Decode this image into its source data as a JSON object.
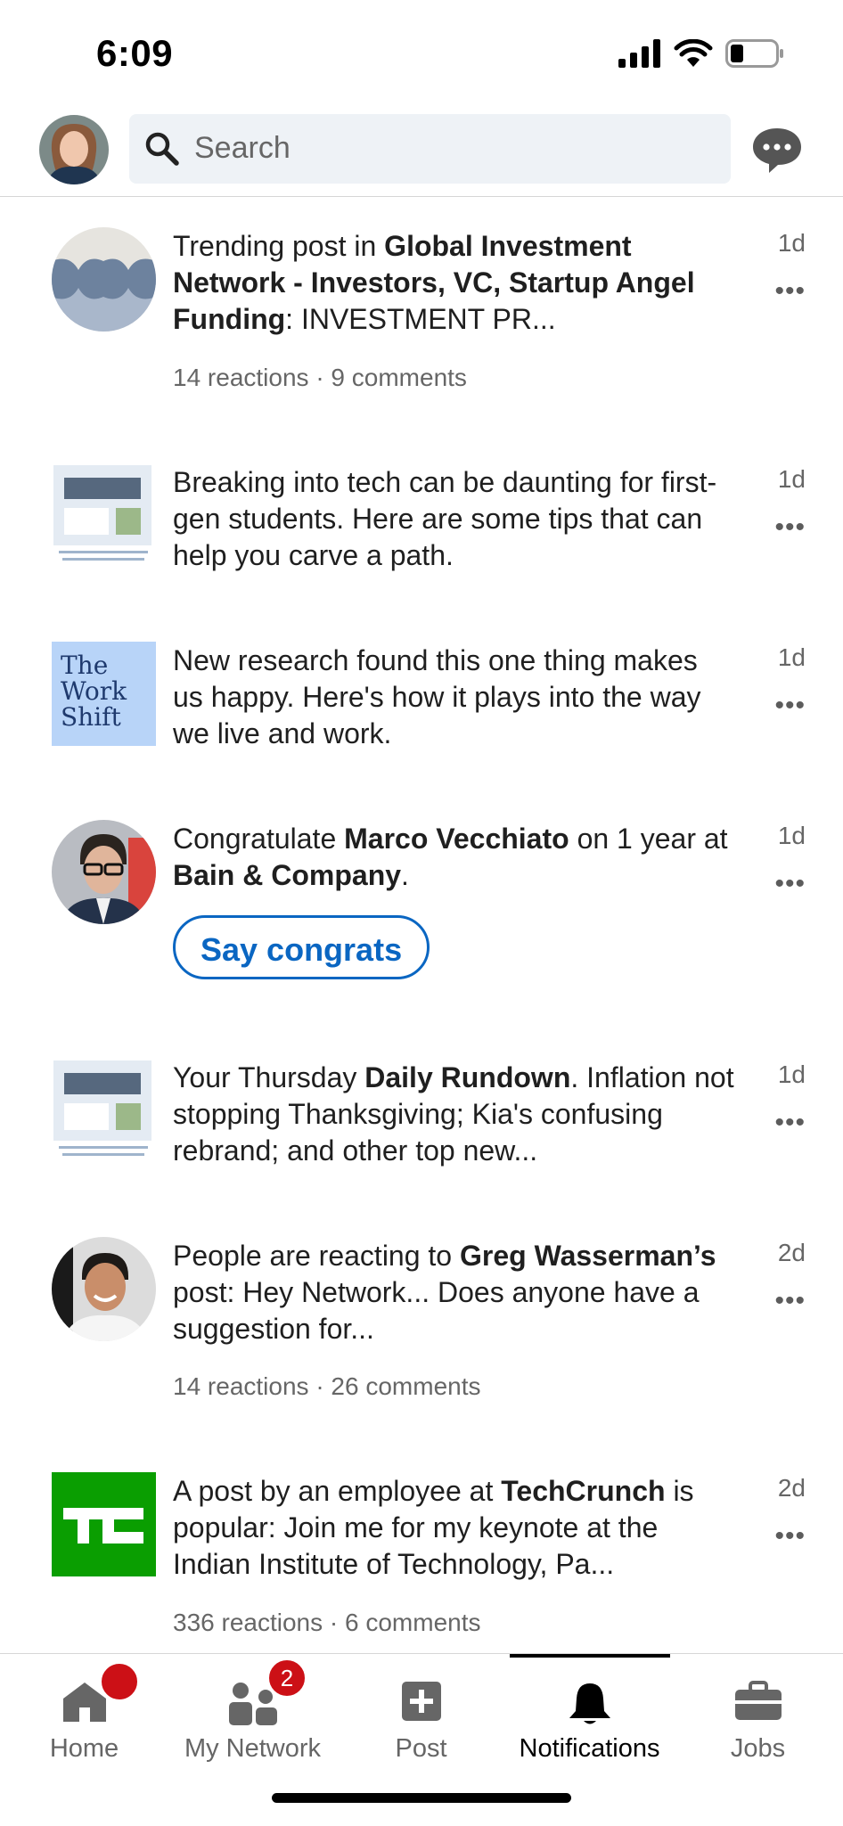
{
  "status_bar": {
    "time": "6:09"
  },
  "header": {
    "search_placeholder": "Search"
  },
  "feed": [
    {
      "id": "trending-post",
      "parts": [
        {
          "t": "Trending post in ",
          "b": false
        },
        {
          "t": "Global Investment Network - Investors, VC, Startup Angel Funding",
          "b": true
        },
        {
          "t": ": INVESTMENT PR...",
          "b": false
        }
      ],
      "meta": "14 reactions · 9 comments",
      "age": "1d"
    },
    {
      "id": "tech-tips",
      "parts": [
        {
          "t": "Breaking into tech can be daunting for first-gen students. Here are some tips that can help you carve a path.",
          "b": false
        }
      ],
      "age": "1d"
    },
    {
      "id": "work-shift",
      "thumb_text": [
        "The",
        "Work",
        "Shift"
      ],
      "parts": [
        {
          "t": "New research found this one thing makes us happy. Here's how it plays into the way we live and work.",
          "b": false
        }
      ],
      "age": "1d"
    },
    {
      "id": "congrats",
      "parts": [
        {
          "t": "Congratulate ",
          "b": false
        },
        {
          "t": "Marco Vecchiato",
          "b": true
        },
        {
          "t": " on 1 year at ",
          "b": false
        },
        {
          "t": "Bain & Company",
          "b": true
        },
        {
          "t": ".",
          "b": false
        }
      ],
      "button": "Say congrats",
      "age": "1d"
    },
    {
      "id": "daily-rundown",
      "parts": [
        {
          "t": "Your Thursday ",
          "b": false
        },
        {
          "t": "Daily Rundown",
          "b": true
        },
        {
          "t": ". Inflation not stopping Thanksgiving; Kia's confusing rebrand; and other top new...",
          "b": false
        }
      ],
      "age": "1d"
    },
    {
      "id": "greg-post",
      "parts": [
        {
          "t": "People are reacting to ",
          "b": false
        },
        {
          "t": "Greg Wasserman’s",
          "b": true
        },
        {
          "t": " post: Hey Network... Does anyone have a suggestion for...",
          "b": false
        }
      ],
      "meta": "14 reactions · 26 comments",
      "age": "2d"
    },
    {
      "id": "techcrunch",
      "parts": [
        {
          "t": "A post by an employee at ",
          "b": false
        },
        {
          "t": "TechCrunch",
          "b": true
        },
        {
          "t": " is popular: Join me for my keynote at the Indian Institute of Technology, Pa...",
          "b": false
        }
      ],
      "meta": "336 reactions · 6 comments",
      "age": "2d"
    }
  ],
  "bottom_nav": {
    "home": "Home",
    "home_badge": "",
    "network": "My Network",
    "network_badge": "2",
    "post": "Post",
    "notifications": "Notifications",
    "jobs": "Jobs"
  },
  "colors": {
    "accent": "#0a66c2",
    "badge": "#cc1016",
    "tc_green": "#0a9e01",
    "work_shift_bg": "#b8d4f8"
  }
}
